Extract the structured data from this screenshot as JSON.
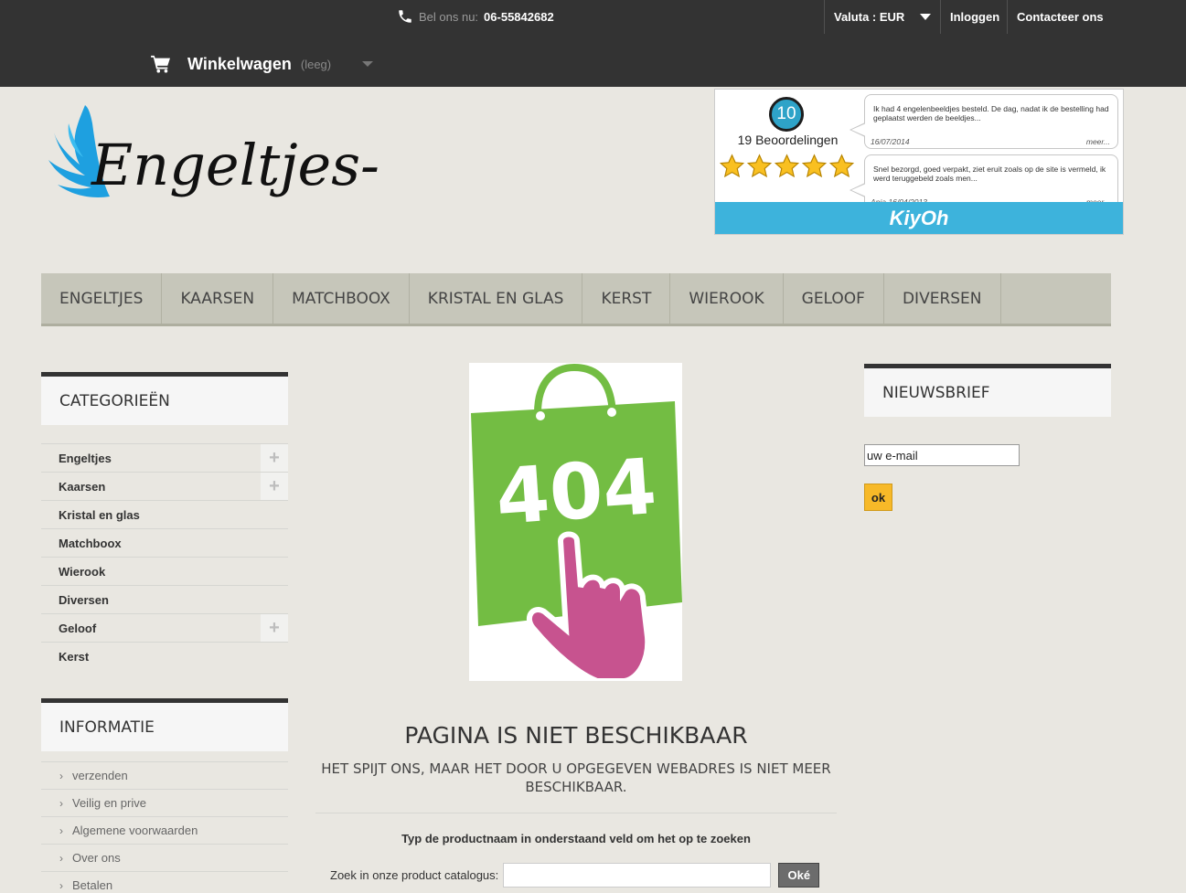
{
  "header": {
    "phone_label": "Bel ons nu:",
    "phone_number": "06-55842682",
    "currency_label": "Valuta : EUR",
    "login_label": "Inloggen",
    "contact_label": "Contacteer ons",
    "cart_label": "Winkelwagen",
    "cart_status": "(leeg)"
  },
  "logo": {
    "text": "Engeltjes-shop"
  },
  "kiyoh": {
    "score": "10",
    "reviews_count": "19 Beoordelingen",
    "rating_stars": 5,
    "reviews": [
      {
        "text": "Ik had 4 engelenbeeldjes besteld. De dag, nadat ik de bestelling had geplaatst werden de beeldjes...",
        "date": "16/07/2014",
        "more": "meer..."
      },
      {
        "text": "Snel bezorgd, goed verpakt, ziet eruit zoals op de site is vermeld, ik werd teruggebeld zoals men...",
        "date": "Anja 16/04/2013",
        "more": "meer..."
      }
    ],
    "brand": "KiyOh"
  },
  "menu": {
    "items": [
      {
        "label": "ENGELTJES"
      },
      {
        "label": "KAARSEN"
      },
      {
        "label": "MATCHBOOX"
      },
      {
        "label": "KRISTAL EN GLAS"
      },
      {
        "label": "KERST"
      },
      {
        "label": "WIEROOK"
      },
      {
        "label": "GELOOF"
      },
      {
        "label": "DIVERSEN"
      }
    ]
  },
  "categories": {
    "title": "CATEGORIEËN",
    "items": [
      {
        "label": "Engeltjes",
        "expandable": true
      },
      {
        "label": "Kaarsen",
        "expandable": true
      },
      {
        "label": "Kristal en glas",
        "expandable": false
      },
      {
        "label": "Matchboox",
        "expandable": false
      },
      {
        "label": "Wierook",
        "expandable": false
      },
      {
        "label": "Diversen",
        "expandable": false
      },
      {
        "label": "Geloof",
        "expandable": true
      },
      {
        "label": "Kerst",
        "expandable": false
      }
    ],
    "expand_symbol": "+"
  },
  "information": {
    "title": "INFORMATIE",
    "items": [
      {
        "label": "verzenden"
      },
      {
        "label": "Veilig en prive"
      },
      {
        "label": "Algemene voorwaarden"
      },
      {
        "label": "Over ons"
      },
      {
        "label": "Betalen"
      }
    ],
    "bullet": "›"
  },
  "error": {
    "image_text": "404",
    "title": "PAGINA IS NIET BESCHIKBAAR",
    "subtitle": "HET SPIJT ONS, MAAR HET DOOR U OPGEGEVEN WEBADRES IS NIET MEER BESCHIKBAAR.",
    "hint": "Typ de productnaam in onderstaand veld om het op te zoeken",
    "search_label": "Zoek in onze product catalogus:",
    "search_value": "",
    "search_button": "Oké"
  },
  "newsletter": {
    "title": "NIEUWSBRIEF",
    "input_value": "uw e-mail",
    "button": "ok"
  },
  "colors": {
    "topbar": "#333333",
    "menu": "#c6c6ba",
    "accent_green": "#73bd43",
    "accent_pink": "#c7538f",
    "kiyoh_blue": "#3db3dc",
    "newsletter_button": "#f7b928"
  }
}
